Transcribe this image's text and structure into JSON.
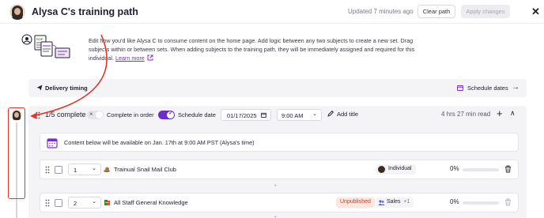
{
  "header": {
    "title": "Alysa C's training path",
    "updated": "Updated 7 minutes ago",
    "clear_label": "Clear path",
    "apply_label": "Apply changes",
    "close_icon": "close-icon"
  },
  "intro": {
    "text": "Edit how you'd like Alysa C to consume content on the home page. Add logic between any two subjects to create a new set. Drag subjects within or between sets. When adding subjects to the training path, they will be immediately assigned and required for this individual.",
    "link": "Learn more"
  },
  "delivery": {
    "label": "Delivery timing",
    "schedule_label": "Schedule dates"
  },
  "set": {
    "complete_count": "1/5 complete",
    "complete_in_order_label": "Complete in order",
    "complete_in_order_on": false,
    "schedule_date_label": "Schedule date",
    "schedule_date_on": true,
    "date_value": "01/17/2025",
    "time_value": "9:00 AM",
    "add_title_label": "Add title",
    "duration": "4 hrs 27 min read",
    "notice": "Content below will be available on Jan. 17th at 9:00 AM PST (Alysa's time)"
  },
  "items": [
    {
      "order": "1",
      "name": "Trainual Snail Mail Club",
      "status": "",
      "assignee": "Individual",
      "progress_label": "0%",
      "progress": 0
    },
    {
      "order": "2",
      "name": "All Staff General Knowledge",
      "status": "Unpublished",
      "assignee": "Sales",
      "assignee_extra": "+1",
      "progress_label": "0%",
      "progress": 0
    }
  ],
  "colors": {
    "accent": "#6b2fc9",
    "annotation": "#e0362a",
    "unpublished_bg": "#fde6df",
    "unpublished_text": "#b3452a"
  }
}
